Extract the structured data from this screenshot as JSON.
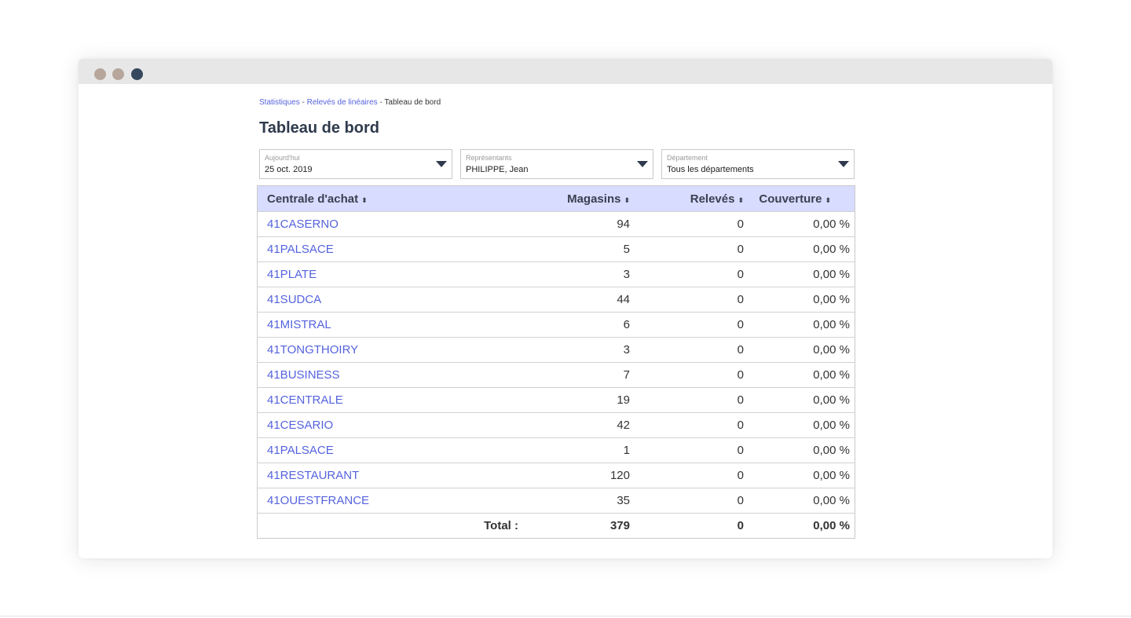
{
  "breadcrumb": {
    "items": [
      "Statistiques",
      "Relevés de linéaires"
    ],
    "current": "Tableau de bord",
    "separator": "-"
  },
  "page": {
    "title": "Tableau de bord"
  },
  "filters": [
    {
      "label": "Aujourd'hui",
      "value": "25 oct. 2019"
    },
    {
      "label": "Représentants",
      "value": "PHILIPPE, Jean"
    },
    {
      "label": "Département",
      "value": "Tous les départements"
    }
  ],
  "table": {
    "columns": [
      "Centrale d'achat",
      "Magasins",
      "Relevés",
      "Couverture"
    ],
    "sort_icon": "⬍",
    "rows": [
      [
        "41CASERNO",
        "94",
        "0",
        "0,00 %"
      ],
      [
        "41PALSACE",
        "5",
        "0",
        "0,00 %"
      ],
      [
        "41PLATE",
        "3",
        "0",
        "0,00 %"
      ],
      [
        "41SUDCA",
        "44",
        "0",
        "0,00 %"
      ],
      [
        "41MISTRAL",
        "6",
        "0",
        "0,00 %"
      ],
      [
        "41TONGTHOIRY",
        "3",
        "0",
        "0,00 %"
      ],
      [
        "41BUSINESS",
        "7",
        "0",
        "0,00 %"
      ],
      [
        "41CENTRALE",
        "19",
        "0",
        "0,00 %"
      ],
      [
        "41CESARIO",
        "42",
        "0",
        "0,00 %"
      ],
      [
        "41PALSACE",
        "1",
        "0",
        "0,00 %"
      ],
      [
        "41RESTAURANT",
        "120",
        "0",
        "0,00 %"
      ],
      [
        "41OUESTFRANCE",
        "35",
        "0",
        "0,00 %"
      ]
    ],
    "total": {
      "label": "Total :",
      "magasins": "379",
      "releves": "0",
      "couverture": "0,00 %"
    }
  },
  "colors": {
    "link": "#5563de",
    "header_bg": "#d8dcff",
    "title": "#2e3a4d",
    "titlebar": "#e7e7e7"
  }
}
